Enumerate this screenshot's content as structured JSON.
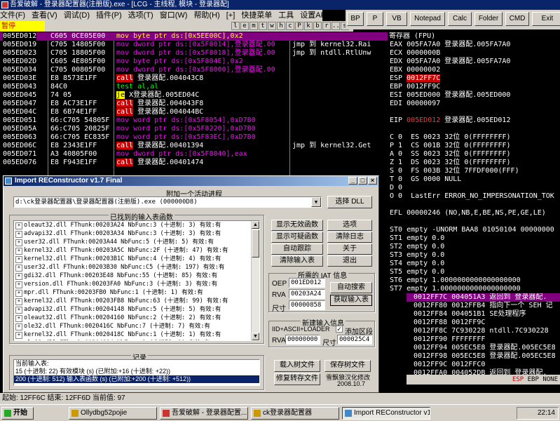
{
  "olly": {
    "title": "吾爱破解 - 登录器配置器(注册版).exe - [LCG - 主线程, 模块 - 登录器配]",
    "menu": [
      "文件(F)",
      "查看(V)",
      "调试(D)",
      "插件(P)",
      "选项(T)",
      "窗口(W)",
      "帮助(H)",
      "[+]",
      "快捷菜单",
      "工具",
      "设置API断点▸"
    ],
    "status_paused": "暂停",
    "toolbar_letters": [
      "l",
      "e",
      "m",
      "t",
      "w",
      "h",
      "c",
      "P",
      "k",
      "b",
      "r",
      "...",
      "s"
    ],
    "plugin_buttons": [
      "BP",
      "P",
      "VB",
      "Notepad",
      "Calc",
      "Folder",
      "CMD",
      "Exit"
    ],
    "cpu_rows": [
      {
        "addr": "005ED012",
        "hex": "C605 0CE05E00",
        "dis": "mov byte ptr ds:[0x5EE00C],0x2",
        "cmt": "",
        "style": "highlight"
      },
      {
        "addr": "005ED019",
        "hex": "C705 14805F00",
        "dis": "mov dword ptr ds:[0x5F8014],登录器配.00",
        "cmt": "jmp 到 kernel32.Rai"
      },
      {
        "addr": "005ED023",
        "hex": "C705 18805F00",
        "dis": "mov dword ptr ds:[0x5F8018],登录器配.00",
        "cmt": "jmp 到 ntdll.RtlUnw"
      },
      {
        "addr": "005ED02D",
        "hex": "C605 4E805F00",
        "dis": "mov byte ptr ds:[0x5F804E],0x2",
        "cmt": ""
      },
      {
        "addr": "005ED034",
        "hex": "C705 00805F00",
        "dis": "mov dword ptr ds:[0x5F8000],登录器配.00",
        "cmt": ""
      },
      {
        "addr": "005ED03E",
        "hex": "E8 8573E1FF",
        "dis": "call 登录器配.004043C8",
        "cmt": ""
      },
      {
        "addr": "005ED043",
        "hex": "84C0",
        "dis": "test al,al",
        "cmt": ""
      },
      {
        "addr": "005ED045",
        "hex": "74 05",
        "dis": "je X登录器配.005ED04C",
        "cmt": ""
      },
      {
        "addr": "005ED047",
        "hex": "E8 AC73E1FF",
        "dis": "call 登录器配.004043F8",
        "cmt": ""
      },
      {
        "addr": "005ED04C",
        "hex": "E8 6B74E1FF",
        "dis": "call 登录器配.004044BC",
        "cmt": ""
      },
      {
        "addr": "005ED051",
        "hex": "66:C705 54805F",
        "dis": "mov word ptr ds:[0x5F8054],0xD7B0",
        "cmt": ""
      },
      {
        "addr": "005ED05A",
        "hex": "66:C705 20825F",
        "dis": "mov word ptr ds:[0x5F8220],0xD7B0",
        "cmt": ""
      },
      {
        "addr": "005ED063",
        "hex": "66:C705 EC835F",
        "dis": "mov word ptr ds:[0x5F83EC],0xD7B0",
        "cmt": ""
      },
      {
        "addr": "005ED06C",
        "hex": "E8 2343E1FF",
        "dis": "call 登录器配.00401394",
        "cmt": "jmp 到 kernel32.Get"
      },
      {
        "addr": "005ED071",
        "hex": "A3 40805F00",
        "dis": "mov dword ptr ds:[0x5F8040],eax",
        "cmt": ""
      },
      {
        "addr": "005ED076",
        "hex": "E8 F943E1FF",
        "dis": "call 登录器配.00401474",
        "cmt": ""
      }
    ],
    "regs_title": "寄存器 (FPU)",
    "registers": [
      {
        "t": "EAX 005FA7A0 登录器配.005FA7A0"
      },
      {
        "t": "ECX 0000000B"
      },
      {
        "t": "EDX 005FA7A0 登录器配.005FA7A0"
      },
      {
        "t": "EBX 00000002"
      },
      {
        "t": "ESP ",
        "v": "0012FF7C",
        "style": "redbg"
      },
      {
        "t": "EBP 0012FF9C"
      },
      {
        "t": "ESI 005ED000 登录器配.005ED000"
      },
      {
        "t": "EDI 00000097"
      },
      {
        "t": ""
      },
      {
        "t": "EIP ",
        "v": "005ED012",
        "rest": " 登录器配.005ED012",
        "style": "red"
      },
      {
        "t": ""
      },
      {
        "t": "C 0  ES 0023 32位 0(FFFFFFFF)"
      },
      {
        "t": "P 1  CS 001B 32位 0(FFFFFFFF)"
      },
      {
        "t": "A 0  SS 0023 32位 0(FFFFFFFF)"
      },
      {
        "t": "Z 1  DS 0023 32位 0(FFFFFFFF)"
      },
      {
        "t": "S 0  FS 003B 32位 7FFDF000(FFF)"
      },
      {
        "t": "T 0  GS 0000 NULL"
      },
      {
        "t": "D 0"
      },
      {
        "t": "O 0  LastErr ERROR_NO_IMPERSONATION_TOK"
      },
      {
        "t": ""
      },
      {
        "t": "EFL 00000246 (NO,NB,E,BE,NS,PE,GE,LE)"
      },
      {
        "t": ""
      },
      {
        "t": "ST0 empty -UNORM BAA8 01050104 00000000"
      },
      {
        "t": "ST1 empty 0.0"
      },
      {
        "t": "ST2 empty 0.0"
      },
      {
        "t": "ST3 empty 0.0"
      },
      {
        "t": "ST4 empty 0.0"
      },
      {
        "t": "ST5 empty 0.0"
      },
      {
        "t": "ST6 empty 1.0000000000000000000"
      },
      {
        "t": "ST7 empty 1.0000000000000000000"
      }
    ],
    "stack": [
      {
        "addr": "0012FF7C",
        "val": "004051A3",
        "cmt": "返回到 登录器配.",
        "style": "highlight"
      },
      {
        "addr": "0012FF80",
        "val": "0012FFB4",
        "cmt": "指向下一个 SEH 记"
      },
      {
        "addr": "0012FF84",
        "val": "004051B1",
        "cmt": "SE处理程序"
      },
      {
        "addr": "0012FF88",
        "val": "0012FF9C",
        "cmt": ""
      },
      {
        "addr": "0012FF8C",
        "val": "7C930228",
        "cmt": "ntdll.7C930228"
      },
      {
        "addr": "0012FF90",
        "val": "FFFFFFFF",
        "cmt": ""
      },
      {
        "addr": "0012FF94",
        "val": "005EC5E8",
        "cmt": "登录器配.005EC5E8"
      },
      {
        "addr": "0012FF98",
        "val": "005EC5E8",
        "cmt": "登录器配.005EC5E8"
      },
      {
        "addr": "0012FF9C",
        "val": "0012FFC0",
        "cmt": ""
      },
      {
        "addr": "0012FFA0",
        "val": "004052DB",
        "cmt": "返回到 登录器配."
      }
    ],
    "stack_footer": [
      "ESP",
      "EBP",
      "NONE"
    ],
    "status_text": "起始: 12FF6C 结束: 12FF6D 当前值: 97"
  },
  "importrec": {
    "title": "Import REConstructor v1.7 Final",
    "attach_label": "附加一个活动进程",
    "process_value": "d:\\ck登录器配置器\\登录器配置器(注册版).exe (000000D8)",
    "select_dll": "选择 DLL",
    "found_label": "已找到的输入表函数",
    "imports": [
      "oleaut32.dll FThunk:00203A24 NbFunc:3 (十进制: 3) 有效:有",
      "advapi32.dll FThunk:00203A34 NbFunc:3 (十进制: 3) 有效:有",
      "user32.dll FThunk:00203A44 NbFunc:5 (十进制: 5) 有效:有",
      "kernel32.dll FThunk:00203A5C NbFunc:2F (十进制: 47) 有效:有",
      "kernel32.dll FThunk:00203B1C NbFunc:4 (十进制: 4) 有效:有",
      "user32.dll FThunk:00203B30 NbFunc:C5 (十进制: 197) 有效:有",
      "gdi32.dll FThunk:00203E48 NbFunc:55 (十进制: 85) 有效:有",
      "version.dll FThunk:00203FA0 NbFunc:3 (十进制: 3) 有效:有",
      "mpr.dll FThunk:00203FB0 NbFunc:1 (十进制: 1) 有效:有",
      "kernel32.dll FThunk:00203FB8 NbFunc:63 (十进制: 99) 有效:有",
      "advapi32.dll FThunk:00204148 NbFunc:5 (十进制: 5) 有效:有",
      "oleaut32.dll FThunk:00204160 NbFunc:2 (十进制: 2) 有效:有",
      "ole32.dll FThunk:0020416C NbFunc:7 (十进制: 7) 有效:有",
      "kernel32.dll FThunk:0020418C NbFunc:1 (十进制: 1) 有效:有",
      "ole32.dll FThunk:00204194 NbFunc:1 (十进制: 1) 有效:有",
      "oleaut32.dll FThunk:0020419C NbFunc:D (十进制: 13) 有效:有"
    ],
    "btn_show_invalid": "显示无效函数",
    "btn_show_suspect": "显示可疑函数",
    "btn_auto_trace": "自动跟踪",
    "btn_clear_imports": "清除输入表",
    "btn_options": "选项",
    "btn_clear_log": "清除日志",
    "btn_about": "关于",
    "btn_exit": "退出",
    "iat_label": "所需的 IAT 信息",
    "oep_label": "OEP",
    "oep_value": "001ED012",
    "rva_label": "RVA",
    "rva_value": "00203A24",
    "size_label": "尺寸",
    "size_value": "00000858",
    "btn_iat_autosearch": "自动搜索",
    "btn_get_imports": "获取输入表",
    "new_import_label": "新建输入信息",
    "iid_label": "IID+ASCII+LOADER",
    "add_section_label": "添加区段",
    "rva2_label": "RVA",
    "rva2_value": "00000000",
    "size2_label": "尺寸",
    "size2_value": "000025C4",
    "log_label": "记录",
    "log_lines": [
      "当前输入表:",
      "15 (十进制: 22) 有效模块 (s) (已附加:+16 (十进制: +22))",
      "200 (十进制: 512) 输入表函数 (s) (已附加:+200 (十进制: +512))"
    ],
    "btn_load_tree": "载入树文件",
    "btn_save_tree": "保存树文件",
    "btn_fix_dump": "修复转存文件",
    "credit": "雪飘狼汉化修改",
    "credit_date": "2008.10.7"
  },
  "taskbar": {
    "start": "开始",
    "tasks": [
      "Ollydbg52pojie",
      "吾爱破解 - 登录器配置...",
      "ck登录器配置器",
      "Import REConstructor v1..."
    ],
    "clock": "22:14"
  }
}
